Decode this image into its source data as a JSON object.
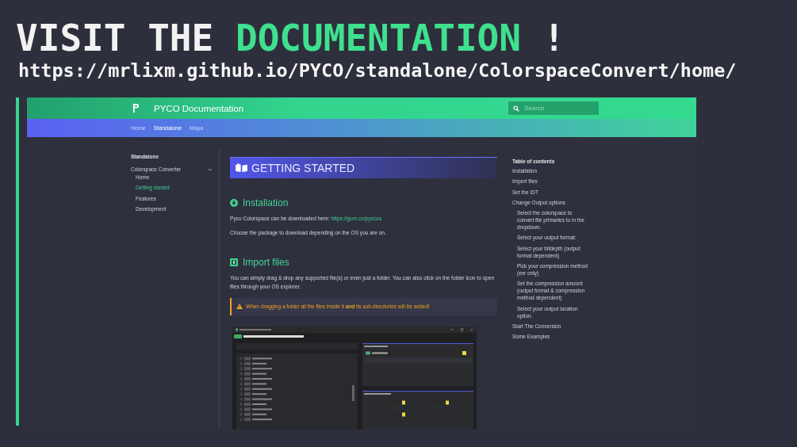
{
  "headline": [
    {
      "text": "VISIT THE",
      "accent": false
    },
    {
      "text": "DOCUMENTATION",
      "accent": true
    },
    {
      "text": "!",
      "accent": false
    }
  ],
  "url": "https://mrlixm.github.io/PYCO/standalone/ColorspaceConvert/home/",
  "site": {
    "title": "PYCO Documentation",
    "search": {
      "placeholder": "Search"
    },
    "tabs": [
      {
        "label": "Home",
        "selected": false
      },
      {
        "label": "Standalone",
        "selected": true
      },
      {
        "label": "Maya",
        "selected": false
      }
    ]
  },
  "sidebar": {
    "heading": "Standalone",
    "section": {
      "label": "Colorspace Converter",
      "expanded": true
    },
    "items": [
      {
        "label": "Home",
        "selected": false
      },
      {
        "label": "Getting started",
        "selected": true
      },
      {
        "label": "Features",
        "selected": false
      },
      {
        "label": "Development",
        "selected": false
      }
    ]
  },
  "article": {
    "title": "GETTING STARTED",
    "installation": {
      "heading": "Installation",
      "text": "Pyco Colorspace can be downloaded here:",
      "link": "https://gum.co/pycocs",
      "note": "Choose the package to download depending on the OS you are on."
    },
    "import": {
      "heading": "Import files",
      "text": "You can simply drag & drop any supported file(s) or even just a folder. You can also click on the folder icon to open files through your OS explorer.",
      "warning": "When dragging a folder all the files inside it **and** its sub-directories will be added!"
    }
  },
  "toc": {
    "heading": "Table of contents",
    "items": [
      {
        "label": "Installation"
      },
      {
        "label": "Import files"
      },
      {
        "label": "Set the IDT"
      },
      {
        "label": "Change Output options",
        "children": [
          {
            "label": "Select the colorspace to convert file primaries to in the dropdown."
          },
          {
            "label": "Select your output format:"
          },
          {
            "label": "Select your bitdepth (output format dependent)"
          },
          {
            "label": "Pick your compression method (exr only)"
          },
          {
            "label": "Set the compression amount (output format & compression method dependent)"
          },
          {
            "label": "Select your output location option."
          }
        ]
      },
      {
        "label": "Start The Conversion"
      },
      {
        "label": "Some Examples"
      }
    ]
  }
}
